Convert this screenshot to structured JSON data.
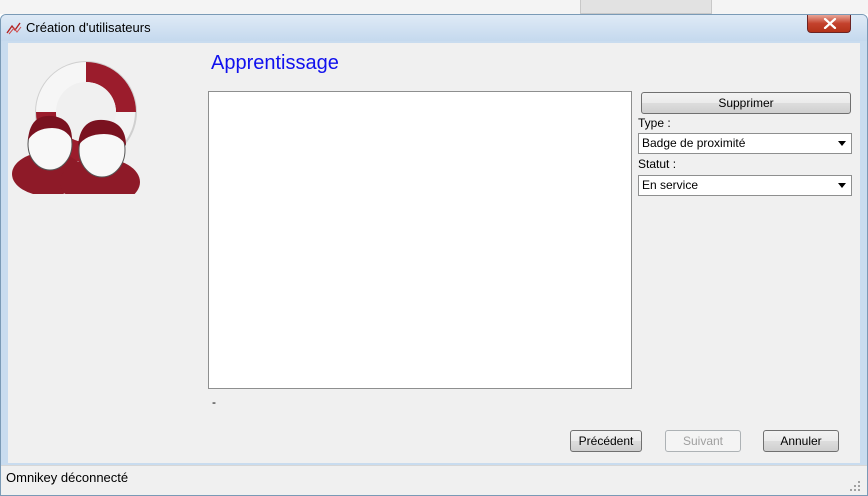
{
  "window": {
    "title": "Création d'utilisateurs"
  },
  "page": {
    "heading": "Apprentissage",
    "dash": "-"
  },
  "actions": {
    "delete_label": "Supprimer",
    "prev_label": "Précédent",
    "next_label": "Suivant",
    "cancel_label": "Annuler"
  },
  "fields": {
    "type_label": "Type :",
    "type_value": "Badge de proximité",
    "statut_label": "Statut :",
    "statut_value": "En service"
  },
  "statusbar": {
    "text": "Omnikey déconnecté"
  },
  "icons": {
    "app": "users-icon",
    "logo": "lifebuoy-users-logo",
    "close": "close-icon",
    "dropdown": "chevron-down-icon",
    "grip": "resize-grip-icon"
  },
  "colors": {
    "heading": "#1010ee",
    "close_button": "#c4412c",
    "logo_red": "#9b1c2c",
    "title_bar": "#c9dcef"
  }
}
